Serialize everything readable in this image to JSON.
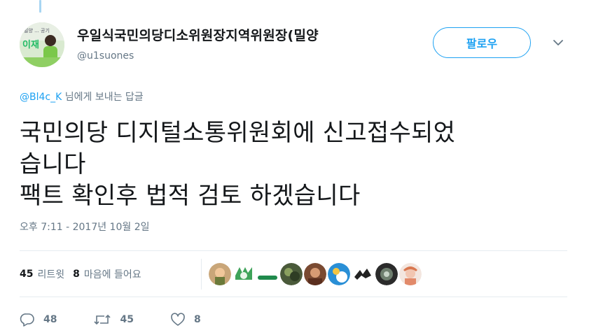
{
  "author": {
    "display_name": "우일식국민의당디소위원장지역위원장(밀양",
    "handle": "@u1suones",
    "avatar_icon": "profile-photo"
  },
  "follow_button": {
    "label": "팔로우"
  },
  "more_menu": {
    "icon": "chevron-down-icon"
  },
  "reply_context": {
    "mention": "@Bl4c_K",
    "suffix": "님에게 보내는 답글"
  },
  "tweet": {
    "text": "국민의당 디지털소통위원회에 신고접수되었\n습니다\n팩트 확인후 법적 검토 하겠습니다"
  },
  "timestamp": "오후 7:11 - 2017년 10월 2일",
  "stats": {
    "retweets_count": "45",
    "retweets_label": "리트윗",
    "likes_count": "8",
    "likes_label": "마음에 들어요"
  },
  "likers": [
    "avatar-1",
    "avatar-2",
    "avatar-3",
    "avatar-4",
    "avatar-5",
    "avatar-6",
    "avatar-7",
    "avatar-8",
    "avatar-9"
  ],
  "actions": {
    "reply_count": "48",
    "retweet_count": "45",
    "like_count": "8"
  },
  "colors": {
    "accent": "#1da1f2",
    "muted": "#657786",
    "text": "#14171a",
    "divider": "#e6ecf0"
  }
}
